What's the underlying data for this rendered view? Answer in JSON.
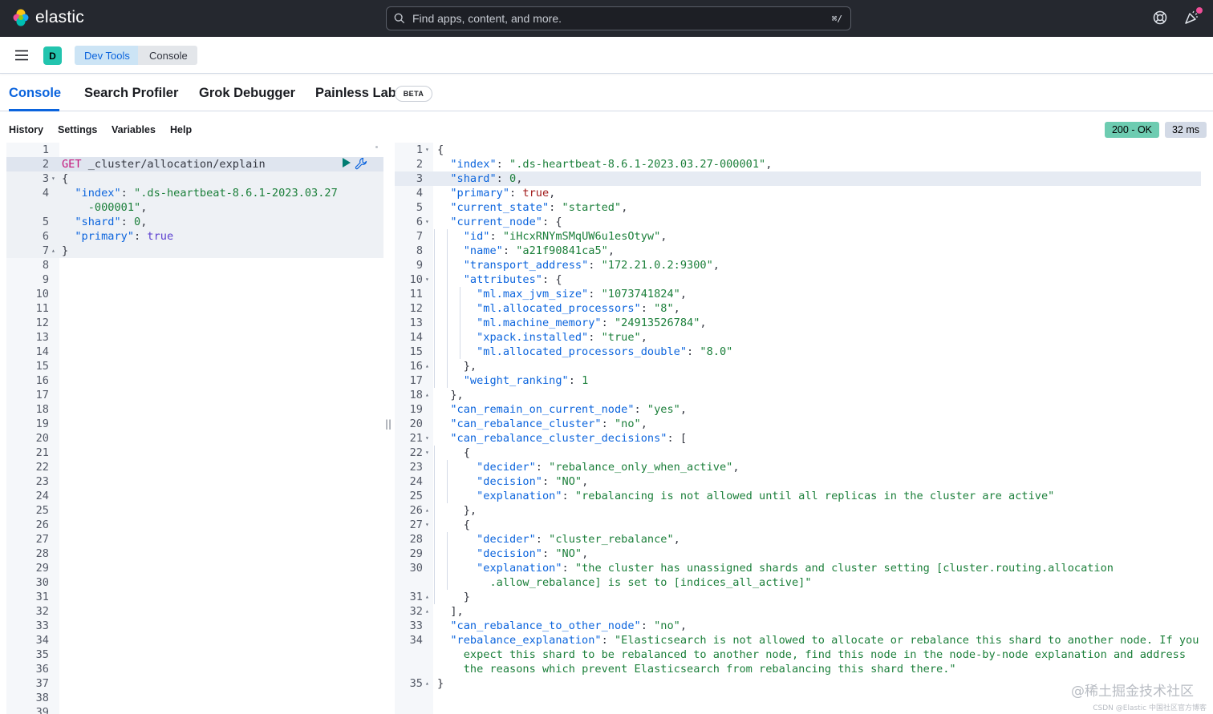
{
  "header": {
    "brand": "elastic",
    "search_placeholder": "Find apps, content, and more.",
    "search_shortcut": "⌘/"
  },
  "subbar": {
    "space_letter": "D",
    "breadcrumbs": [
      "Dev Tools",
      "Console"
    ]
  },
  "tabs": [
    {
      "label": "Console",
      "active": true
    },
    {
      "label": "Search Profiler",
      "active": false
    },
    {
      "label": "Grok Debugger",
      "active": false
    },
    {
      "label": "Painless Lab",
      "active": false
    }
  ],
  "beta_badge": "BETA",
  "toolbar": {
    "items": [
      "History",
      "Settings",
      "Variables",
      "Help"
    ],
    "status": "200 - OK",
    "duration": "32 ms"
  },
  "request_editor": {
    "line_count": 39,
    "method": "GET",
    "path": " _cluster/allocation/explain",
    "lines": [
      "",
      "GET _cluster/allocation/explain",
      "{",
      "  \"index\": \".ds-heartbeat-8.6.1-2023.03.27",
      "    -000001\",",
      "  \"shard\": 0,",
      "  \"primary\": true",
      "}"
    ]
  },
  "response_editor": {
    "lines": [
      "{",
      "  \"index\": \".ds-heartbeat-8.6.1-2023.03.27-000001\",",
      "  \"shard\": 0,",
      "  \"primary\": true,",
      "  \"current_state\": \"started\",",
      "  \"current_node\": {",
      "    \"id\": \"iHcxRNYmSMqUW6u1esOtyw\",",
      "    \"name\": \"a21f90841ca5\",",
      "    \"transport_address\": \"172.21.0.2:9300\",",
      "    \"attributes\": {",
      "      \"ml.max_jvm_size\": \"1073741824\",",
      "      \"ml.allocated_processors\": \"8\",",
      "      \"ml.machine_memory\": \"24913526784\",",
      "      \"xpack.installed\": \"true\",",
      "      \"ml.allocated_processors_double\": \"8.0\"",
      "    },",
      "    \"weight_ranking\": 1",
      "  },",
      "  \"can_remain_on_current_node\": \"yes\",",
      "  \"can_rebalance_cluster\": \"no\",",
      "  \"can_rebalance_cluster_decisions\": [",
      "    {",
      "      \"decider\": \"rebalance_only_when_active\",",
      "      \"decision\": \"NO\",",
      "      \"explanation\": \"rebalancing is not allowed until all replicas in the cluster are active\"",
      "    },",
      "    {",
      "      \"decider\": \"cluster_rebalance\",",
      "      \"decision\": \"NO\",",
      "      \"explanation\": \"the cluster has unassigned shards and cluster setting [cluster.routing.allocation",
      "        .allow_rebalance] is set to [indices_all_active]\"",
      "    }",
      "  ],",
      "  \"can_rebalance_to_other_node\": \"no\",",
      "  \"rebalance_explanation\": \"Elasticsearch is not allowed to allocate or rebalance this shard to another node. If you",
      "    expect this shard to be rebalanced to another node, find this node in the node-by-node explanation and address",
      "    the reasons which prevent Elasticsearch from rebalancing this shard there.\"",
      "}"
    ]
  },
  "watermark": "@稀土掘金技术社区",
  "watermark_small": "CSDN @Elastic 中国社区官方博客"
}
